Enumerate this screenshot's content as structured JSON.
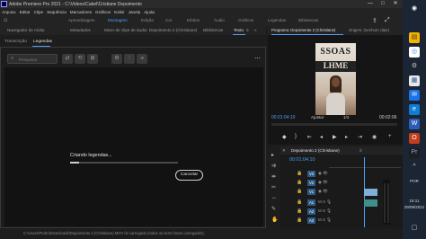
{
  "titlebar": {
    "title": "Adobe Premiere Pro 2021 - C:\\Videos\\Cabel\\Cristiane Depoimento",
    "minimize": "—",
    "maximize": "□",
    "close": "✕"
  },
  "menubar": {
    "items": [
      "Arquivo",
      "Editar",
      "Clipe",
      "Sequência",
      "Marcadores",
      "Gráficos",
      "Exibir",
      "Janela",
      "Ajuda"
    ]
  },
  "workspaces": {
    "items": [
      "Aprendizagem",
      "Montagem",
      "Edição",
      "Cor",
      "Efeitos",
      "Áudio",
      "Gráficos",
      "Legendas",
      "Bibliotecas"
    ],
    "active_index": 1
  },
  "left_panel": {
    "tabs": [
      "Navegador de mídia",
      "Metadados",
      "Mixer de clipe de áudio: Depoimento 2 (Christiane)",
      "Bibliotecas",
      "Texto"
    ],
    "active_tab": "Texto",
    "sub_tabs": [
      "Transcrição",
      "Legendas"
    ],
    "active_sub_tab": "Legendas",
    "search_placeholder": "Pesquisar",
    "progress": {
      "label": "Criando legendas...",
      "fraction": 0.08
    },
    "cancel_label": "Cancelar"
  },
  "program_monitor": {
    "tabs": [
      "Programa: Depoimento 2 (Christiane)",
      "Origem: (nenhum clipe)"
    ],
    "sign_top": "SSOAS",
    "sign_bottom": "LHME",
    "timecode_left": "00:01:04:10",
    "fit": "Ajustar",
    "scale": "1/2",
    "timecode_right": "00:02:06"
  },
  "timeline": {
    "tab": "Depoimento 2 (Christiane)",
    "timecode": "00:01:04:10",
    "video_tracks": [
      "V3",
      "V2",
      "V1"
    ],
    "audio_tracks": [
      "A1",
      "A2",
      "A3"
    ]
  },
  "status_bar": {
    "text": "C:\\Users\\Pedro\\Downloads\\Depoimento 2 (Christiane).MOV foi carregado (todos os itens foram carregados)."
  },
  "taskbar": {
    "time": "15:11",
    "date": "29/09/2021",
    "lang": "POR"
  },
  "colors": {
    "accent": "#4d9ffb",
    "panel_bg": "#1d1d1d",
    "content_bg": "#121212"
  }
}
